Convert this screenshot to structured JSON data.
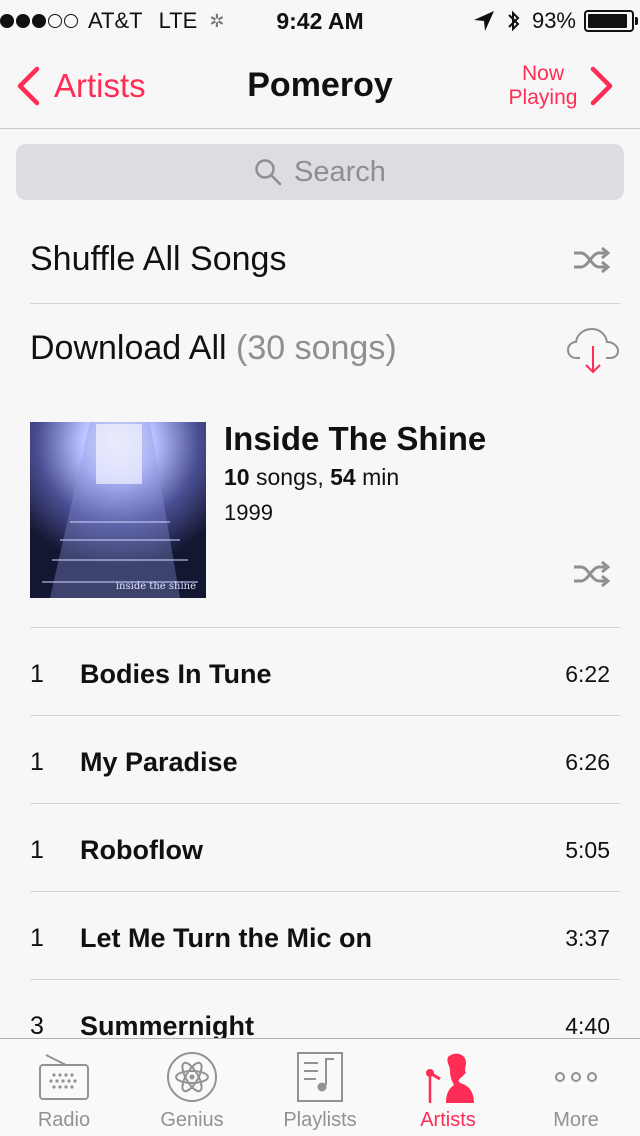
{
  "status_bar": {
    "carrier": "AT&T",
    "network": "LTE",
    "time": "9:42 AM",
    "battery_percent": "93%",
    "battery_level": 0.93,
    "signal_bars_filled": 3,
    "signal_bars_total": 5
  },
  "nav": {
    "back_label": "Artists",
    "title": "Pomeroy",
    "now_playing_label": "Now Playing"
  },
  "search": {
    "placeholder": "Search"
  },
  "actions": {
    "shuffle_label": "Shuffle All Songs",
    "download_label": "Download All",
    "download_count": "(30 songs)"
  },
  "album": {
    "title": "Inside The Shine",
    "song_count": "10",
    "song_word": "songs,",
    "duration": "54",
    "duration_unit": "min",
    "year": "1999",
    "art_caption": "inside the shine"
  },
  "tracks": [
    {
      "number": "1",
      "title": "Bodies In Tune",
      "duration": "6:22"
    },
    {
      "number": "1",
      "title": "My Paradise",
      "duration": "6:26"
    },
    {
      "number": "1",
      "title": "Roboflow",
      "duration": "5:05"
    },
    {
      "number": "1",
      "title": "Let Me Turn the Mic on",
      "duration": "3:37"
    },
    {
      "number": "3",
      "title": "Summernight",
      "duration": "4:40"
    }
  ],
  "tab_bar": {
    "tabs": [
      {
        "label": "Radio",
        "icon": "radio-icon"
      },
      {
        "label": "Genius",
        "icon": "genius-atom-icon"
      },
      {
        "label": "Playlists",
        "icon": "playlists-icon"
      },
      {
        "label": "Artists",
        "icon": "artists-singer-icon",
        "active": true
      },
      {
        "label": "More",
        "icon": "more-dots-icon"
      }
    ]
  },
  "colors": {
    "accent": "#ff2d55",
    "inactive_tab": "#929292",
    "secondary_text": "#8e8e93"
  }
}
